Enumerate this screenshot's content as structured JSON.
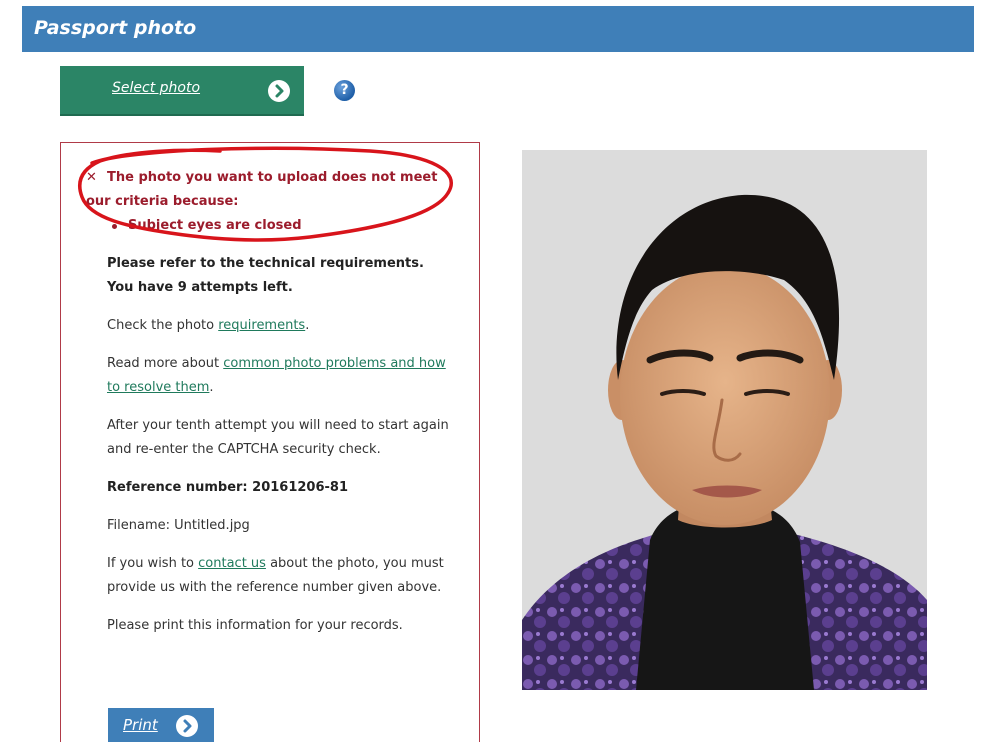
{
  "header": {
    "title": "Passport photo"
  },
  "select_button": {
    "label": "Select photo",
    "icon": "arrow-right-circle-icon"
  },
  "help": {
    "icon": "question-circle-icon",
    "glyph": "?"
  },
  "error": {
    "icon_glyph": "✕",
    "line1": "The photo you want to upload does not meet",
    "line2": "our criteria because:",
    "reason": "Subject eyes are closed"
  },
  "info": {
    "requirements_line1": "Please refer to the technical requirements.",
    "requirements_line2": "You have 9 attempts left.",
    "check_prefix": "Check the photo ",
    "check_link": "requirements",
    "check_suffix": ".",
    "read_prefix": "Read more about ",
    "read_link": "common photo problems and how to resolve them",
    "read_suffix": ".",
    "tenth_attempt": "After your tenth attempt you will need to start again and re-enter the CAPTCHA security check.",
    "reference_label": "Reference number: 20161206-81",
    "filename": "Filename: Untitled.jpg",
    "contact_prefix": "If you wish to ",
    "contact_link": "contact us",
    "contact_suffix": " about the photo, you must provide us with the reference number given above.",
    "print_info": "Please print this information for your records."
  },
  "print_button": {
    "label": "Print",
    "icon": "arrow-right-circle-icon"
  },
  "colors": {
    "header": "#3f7fb8",
    "select_button": "#2b8566",
    "error_text": "#9b1c2c",
    "link": "#1f7a5c",
    "annotation": "#d8141b"
  }
}
